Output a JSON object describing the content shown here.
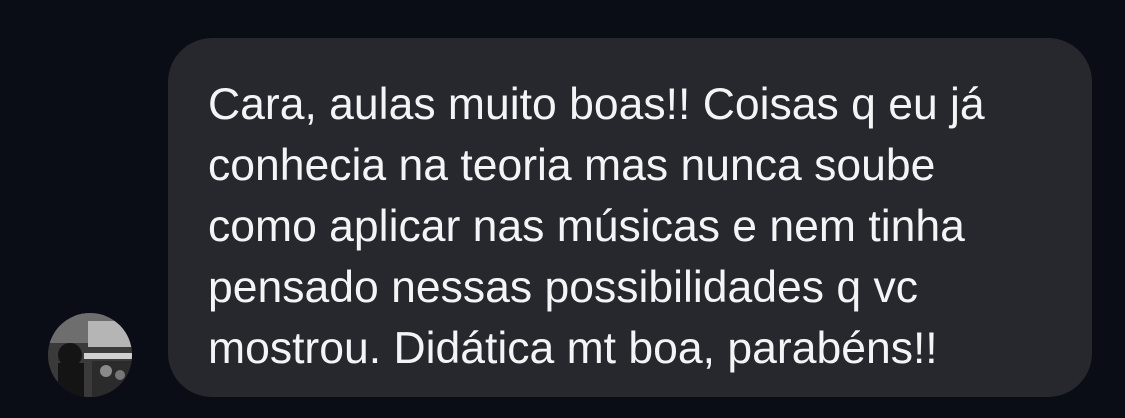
{
  "conversation": {
    "message": {
      "lines": [
        "Cara, aulas muito boas!! Coisas q eu já",
        "conhecia na teoria mas nunca soube",
        "como aplicar nas músicas e nem tinha",
        "pensado nessas possibilidades q vc",
        "mostrou. Didática mt boa, parabéns!!"
      ]
    },
    "avatar": {
      "icon": "user-profile-photo"
    }
  },
  "colors": {
    "background": "#0b0d16",
    "bubble": "#26282d",
    "text": "#f4f4f6"
  }
}
